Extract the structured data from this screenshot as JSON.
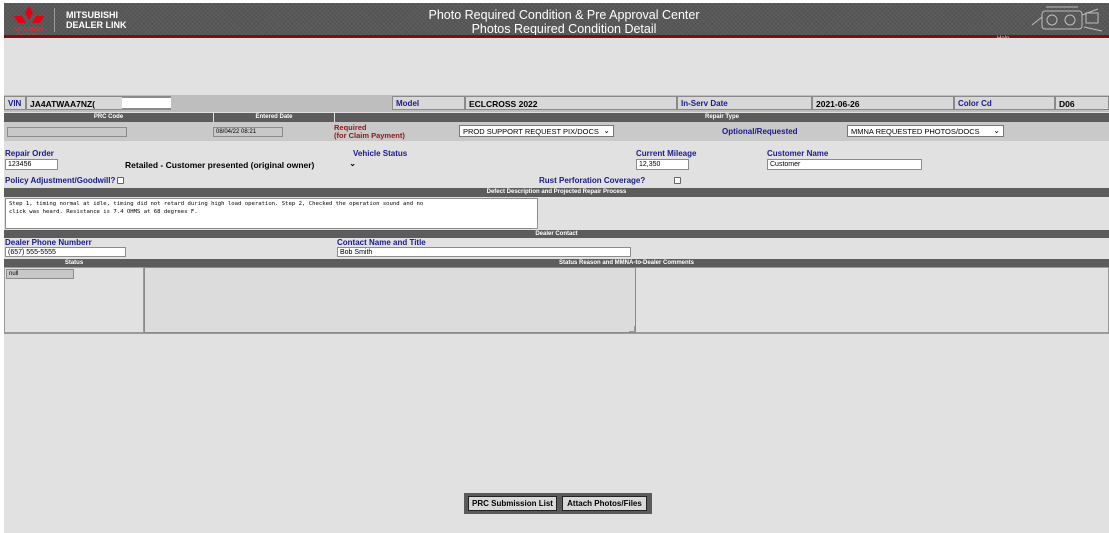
{
  "header": {
    "brand_line1": "MITSUBISHI",
    "brand_line2": "DEALER LINK",
    "logo_sub": "MITSUBISHI MOTORS",
    "title_line1": "Photo Required Condition & Pre Approval Center",
    "title_line2": "Photos Required Condition Detail",
    "help": "Help"
  },
  "vehicle": {
    "vin_label": "VIN",
    "vin_value": "JA4ATWAA7NZ(",
    "model_label": "Model",
    "model_value": "ECLCROSS 2022",
    "in_serv_label": "In-Serv Date",
    "in_serv_value": "2021-06-26",
    "color_label": "Color Cd",
    "color_value": "D06"
  },
  "prc": {
    "prc_code_header": "PRC Code",
    "entered_date_header": "Entered Date",
    "repair_type_header": "Repair Type",
    "prc_code_value": "",
    "entered_date_value": "08/04/22 08:21",
    "required_label": "Required",
    "required_sub": "(for Claim Payment)",
    "required_select": "PROD SUPPORT REQUEST PIX/DOCS",
    "optional_label": "Optional/Requested",
    "optional_select": "MMNA REQUESTED PHOTOS/DOCS"
  },
  "repair": {
    "repair_order_label": "Repair Order",
    "repair_order_value": "123456",
    "vehicle_status_label": "Vehicle Status",
    "vehicle_status_select": "Retailed - Customer presented (original owner)",
    "mileage_label": "Current Mileage",
    "mileage_value": "12,350",
    "customer_label": "Customer Name",
    "customer_value": "Customer",
    "policy_label": "Policy Adjustment/Goodwill?",
    "rust_label": "Rust Perforation Coverage?"
  },
  "defect": {
    "header": "Defect Description and Projected Repair Process",
    "text": "Step 1, timing normal at idle, timing did not retard during high load operation. Step 2, Checked the operation sound and no\nclick was heard. Resistance is 7.4 OHMS at 68 degrees F."
  },
  "contact": {
    "header": "Dealer Contact",
    "phone_label": "Dealer Phone Numberr",
    "phone_value": "(657) 555-5555",
    "name_label": "Contact Name and Title",
    "name_value": "Bob Smith"
  },
  "status": {
    "status_header": "Status",
    "reason_header": "Status Reason and MMNA-to-Dealer Comments",
    "status_value": "null"
  },
  "buttons": {
    "submission_list": "PRC Submission List",
    "attach_photos": "Attach Photos/Files"
  },
  "colors": {
    "header_bg": "#585858",
    "accent_red": "#7a1010",
    "label_blue": "#1a1a8a",
    "required_red": "#8b1a1a",
    "page_bg": "#e1e1e1"
  }
}
